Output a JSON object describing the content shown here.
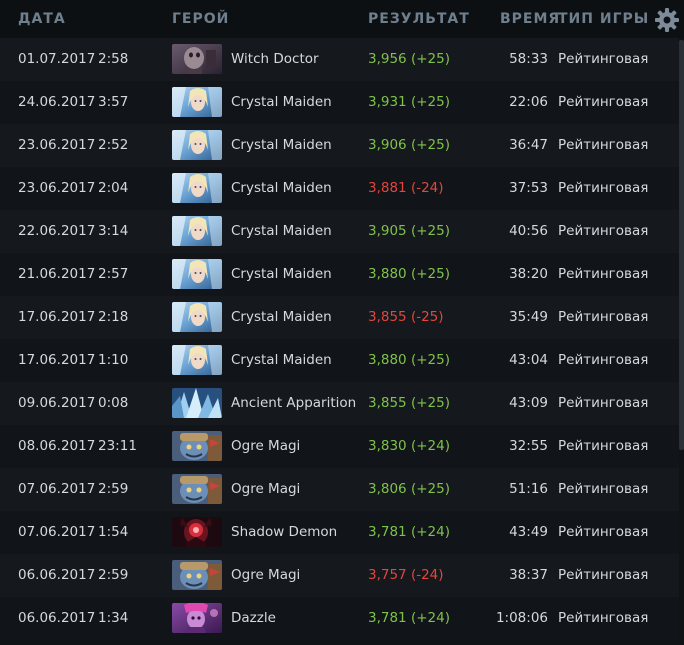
{
  "header": {
    "date": "ДАТА",
    "hero": "ГЕРОЙ",
    "result": "РЕЗУЛЬТАТ",
    "duration": "ВРЕМЯ",
    "game_type": "ТИП ИГРЫ",
    "settings_icon": "gear-icon"
  },
  "colors": {
    "win": "#7fc24a",
    "loss": "#e2463c",
    "header_text": "#6f7f8e"
  },
  "matches": [
    {
      "date": "01.07.2017",
      "time": "2:58",
      "hero": "Witch Doctor",
      "result": "3,956 (+25)",
      "outcome": "win",
      "duration": "58:33",
      "type": "Рейтинговая",
      "portrait": "witch-doctor"
    },
    {
      "date": "24.06.2017",
      "time": "3:57",
      "hero": "Crystal Maiden",
      "result": "3,931 (+25)",
      "outcome": "win",
      "duration": "22:06",
      "type": "Рейтинговая",
      "portrait": "crystal-maiden"
    },
    {
      "date": "23.06.2017",
      "time": "2:52",
      "hero": "Crystal Maiden",
      "result": "3,906 (+25)",
      "outcome": "win",
      "duration": "36:47",
      "type": "Рейтинговая",
      "portrait": "crystal-maiden"
    },
    {
      "date": "23.06.2017",
      "time": "2:04",
      "hero": "Crystal Maiden",
      "result": "3,881 (-24)",
      "outcome": "loss",
      "duration": "37:53",
      "type": "Рейтинговая",
      "portrait": "crystal-maiden"
    },
    {
      "date": "22.06.2017",
      "time": "3:14",
      "hero": "Crystal Maiden",
      "result": "3,905 (+25)",
      "outcome": "win",
      "duration": "40:56",
      "type": "Рейтинговая",
      "portrait": "crystal-maiden"
    },
    {
      "date": "21.06.2017",
      "time": "2:57",
      "hero": "Crystal Maiden",
      "result": "3,880 (+25)",
      "outcome": "win",
      "duration": "38:20",
      "type": "Рейтинговая",
      "portrait": "crystal-maiden"
    },
    {
      "date": "17.06.2017",
      "time": "2:18",
      "hero": "Crystal Maiden",
      "result": "3,855 (-25)",
      "outcome": "loss",
      "duration": "35:49",
      "type": "Рейтинговая",
      "portrait": "crystal-maiden"
    },
    {
      "date": "17.06.2017",
      "time": "1:10",
      "hero": "Crystal Maiden",
      "result": "3,880 (+25)",
      "outcome": "win",
      "duration": "43:04",
      "type": "Рейтинговая",
      "portrait": "crystal-maiden"
    },
    {
      "date": "09.06.2017",
      "time": "0:08",
      "hero": "Ancient Apparition",
      "result": "3,855 (+25)",
      "outcome": "win",
      "duration": "43:09",
      "type": "Рейтинговая",
      "portrait": "ancient-apparition"
    },
    {
      "date": "08.06.2017",
      "time": "23:11",
      "hero": "Ogre Magi",
      "result": "3,830 (+24)",
      "outcome": "win",
      "duration": "32:55",
      "type": "Рейтинговая",
      "portrait": "ogre-magi"
    },
    {
      "date": "07.06.2017",
      "time": "2:59",
      "hero": "Ogre Magi",
      "result": "3,806 (+25)",
      "outcome": "win",
      "duration": "51:16",
      "type": "Рейтинговая",
      "portrait": "ogre-magi"
    },
    {
      "date": "07.06.2017",
      "time": "1:54",
      "hero": "Shadow Demon",
      "result": "3,781 (+24)",
      "outcome": "win",
      "duration": "43:49",
      "type": "Рейтинговая",
      "portrait": "shadow-demon"
    },
    {
      "date": "06.06.2017",
      "time": "2:59",
      "hero": "Ogre Magi",
      "result": "3,757 (-24)",
      "outcome": "loss",
      "duration": "38:37",
      "type": "Рейтинговая",
      "portrait": "ogre-magi"
    },
    {
      "date": "06.06.2017",
      "time": "1:34",
      "hero": "Dazzle",
      "result": "3,781 (+24)",
      "outcome": "win",
      "duration": "1:08:06",
      "type": "Рейтинговая",
      "portrait": "dazzle"
    }
  ]
}
